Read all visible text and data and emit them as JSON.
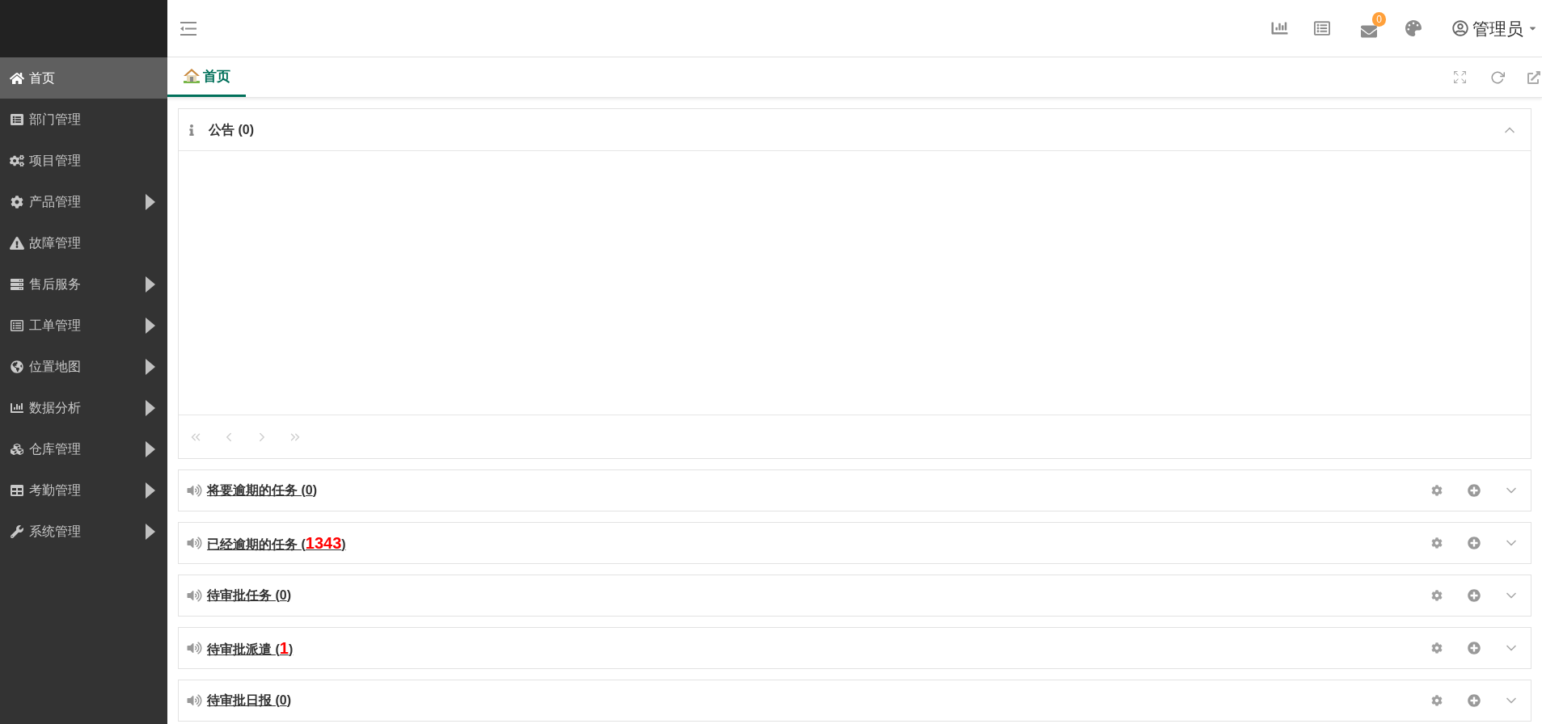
{
  "sidebar": {
    "items": [
      {
        "label": "首页",
        "selected": true,
        "has_submenu": false
      },
      {
        "label": "部门管理",
        "selected": false,
        "has_submenu": false
      },
      {
        "label": "项目管理",
        "selected": false,
        "has_submenu": false
      },
      {
        "label": "产品管理",
        "selected": false,
        "has_submenu": true
      },
      {
        "label": "故障管理",
        "selected": false,
        "has_submenu": false
      },
      {
        "label": "售后服务",
        "selected": false,
        "has_submenu": true
      },
      {
        "label": "工单管理",
        "selected": false,
        "has_submenu": true
      },
      {
        "label": "位置地图",
        "selected": false,
        "has_submenu": true
      },
      {
        "label": "数据分析",
        "selected": false,
        "has_submenu": true
      },
      {
        "label": "仓库管理",
        "selected": false,
        "has_submenu": true
      },
      {
        "label": "考勤管理",
        "selected": false,
        "has_submenu": true
      },
      {
        "label": "系统管理",
        "selected": false,
        "has_submenu": true
      }
    ]
  },
  "header": {
    "message_count": "0",
    "user_name": "管理员"
  },
  "tabs": [
    {
      "label": "首页",
      "selected": true
    }
  ],
  "announcement": {
    "title": "公告 (0)",
    "expanded": true,
    "pager": [
      {
        "disabled": true
      },
      {
        "disabled": true
      },
      {
        "disabled": true
      },
      {
        "disabled": true
      }
    ]
  },
  "widgets": [
    {
      "label": "将要逾期的任务 (",
      "count": "0",
      "label_end": ")",
      "alert": false,
      "expanded": false
    },
    {
      "label": "已经逾期的任务 (",
      "count": "1343",
      "label_end": ")",
      "alert": true,
      "expanded": false
    },
    {
      "label": "待审批任务 (",
      "count": "0",
      "label_end": ")",
      "alert": false,
      "expanded": false
    },
    {
      "label": "待审批派遣 (",
      "count": "1",
      "label_end": ")",
      "alert": true,
      "expanded": false
    },
    {
      "label": "待审批日报 (",
      "count": "0",
      "label_end": ")",
      "alert": false,
      "expanded": false
    }
  ]
}
